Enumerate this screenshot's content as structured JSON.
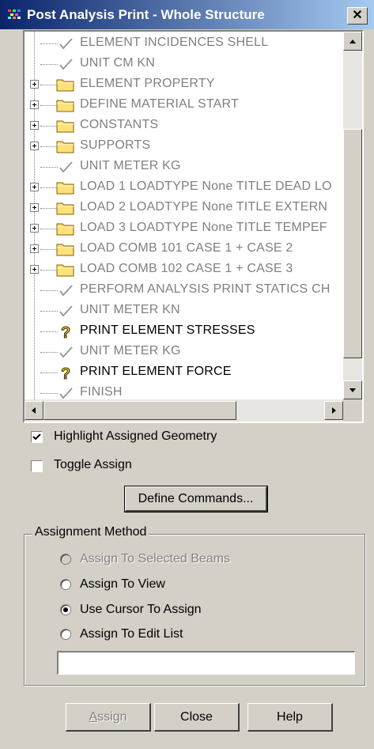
{
  "window": {
    "title": "Post Analysis Print - Whole Structure",
    "close_glyph": "✕"
  },
  "tree": {
    "items": [
      {
        "label": "ELEMENT INCIDENCES SHELL",
        "icon": "check-icon",
        "expandable": false,
        "active": false
      },
      {
        "label": "UNIT CM KN",
        "icon": "check-icon",
        "expandable": false,
        "active": false
      },
      {
        "label": "ELEMENT PROPERTY",
        "icon": "folder-icon",
        "expandable": true,
        "active": false
      },
      {
        "label": "DEFINE MATERIAL START",
        "icon": "folder-icon",
        "expandable": true,
        "active": false
      },
      {
        "label": "CONSTANTS",
        "icon": "folder-icon",
        "expandable": true,
        "active": false
      },
      {
        "label": "SUPPORTS",
        "icon": "folder-icon",
        "expandable": true,
        "active": false
      },
      {
        "label": "UNIT METER KG",
        "icon": "check-icon",
        "expandable": false,
        "active": false
      },
      {
        "label": "LOAD 1 LOADTYPE None  TITLE DEAD LO",
        "icon": "folder-icon",
        "expandable": true,
        "active": false
      },
      {
        "label": "LOAD 2 LOADTYPE None  TITLE EXTERN",
        "icon": "folder-icon",
        "expandable": true,
        "active": false
      },
      {
        "label": "LOAD 3 LOADTYPE None  TITLE TEMPEF",
        "icon": "folder-icon",
        "expandable": true,
        "active": false
      },
      {
        "label": "LOAD COMB 101 CASE 1  + CASE 2",
        "icon": "folder-icon",
        "expandable": true,
        "active": false
      },
      {
        "label": "LOAD COMB 102 CASE 1 + CASE 3",
        "icon": "folder-icon",
        "expandable": true,
        "active": false
      },
      {
        "label": "PERFORM ANALYSIS PRINT STATICS CH",
        "icon": "check-icon",
        "expandable": false,
        "active": false
      },
      {
        "label": "UNIT METER KN",
        "icon": "check-icon",
        "expandable": false,
        "active": false
      },
      {
        "label": "PRINT ELEMENT STRESSES",
        "icon": "question-icon",
        "expandable": false,
        "active": true
      },
      {
        "label": "UNIT METER KG",
        "icon": "check-icon",
        "expandable": false,
        "active": false
      },
      {
        "label": "PRINT ELEMENT FORCE",
        "icon": "question-icon",
        "expandable": false,
        "active": true
      },
      {
        "label": "FINISH",
        "icon": "check-icon",
        "expandable": false,
        "active": false
      }
    ]
  },
  "options": {
    "highlight_label": "Highlight Assigned Geometry",
    "highlight_checked": true,
    "toggle_label": "Toggle Assign",
    "toggle_checked": false
  },
  "define_button": "Define Commands...",
  "assignment": {
    "group_label": "Assignment Method",
    "options": [
      {
        "label": "Assign To Selected Beams",
        "enabled": false,
        "selected": false
      },
      {
        "label": "Assign To View",
        "enabled": true,
        "selected": false
      },
      {
        "label": "Use Cursor To Assign",
        "enabled": true,
        "selected": true
      },
      {
        "label": "Assign To Edit List",
        "enabled": true,
        "selected": false
      }
    ],
    "edit_list_value": ""
  },
  "buttons": {
    "assign_prefix": "A",
    "assign_rest": "ssign",
    "close": "Close",
    "help": "Help"
  },
  "colors": {
    "title_start": "#0a246a",
    "title_end": "#a6caf0",
    "folder": "#ffe07a",
    "check": "#9a9a9a",
    "question": "#f0c000",
    "face": "#d4d0c8"
  }
}
